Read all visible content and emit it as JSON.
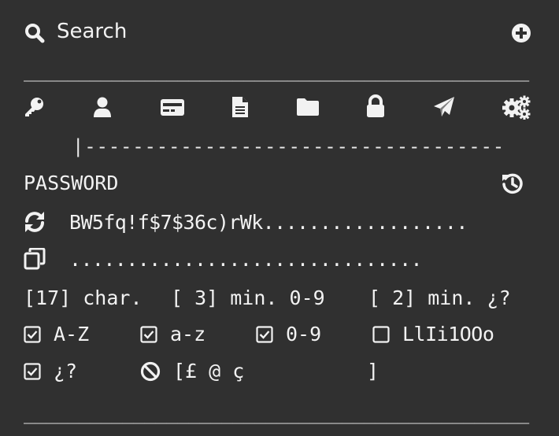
{
  "search": {
    "label": "Search",
    "icon": "search-icon",
    "add_icon": "plus-circle-icon"
  },
  "separators": {
    "top": "______________________________________________",
    "tab_indicator": "|-----------------------------------",
    "bottom": "______________________________________________"
  },
  "tabs": [
    {
      "name": "key",
      "icon": "key-icon"
    },
    {
      "name": "user",
      "icon": "user-icon"
    },
    {
      "name": "card",
      "icon": "credit-card-icon"
    },
    {
      "name": "document",
      "icon": "file-text-icon"
    },
    {
      "name": "folder",
      "icon": "folder-icon"
    },
    {
      "name": "lock",
      "icon": "lock-icon"
    },
    {
      "name": "send",
      "icon": "paper-plane-icon"
    },
    {
      "name": "settings",
      "icon": "gears-icon"
    }
  ],
  "password": {
    "heading": "PASSWORD",
    "history_icon": "history-icon",
    "regenerate_icon": "refresh-icon",
    "value": "BW5fq!f$7$36c)rWk..................",
    "copy_icon": "copy-icon",
    "copy_line": "..............................."
  },
  "options": {
    "length": "[17] char.",
    "min_numbers": "[ 3] min. 0-9",
    "min_special": "[ 2] min. ¿?",
    "uppercase": {
      "label": "A-Z",
      "checked": true
    },
    "lowercase": {
      "label": "a-z",
      "checked": true
    },
    "numbers": {
      "label": "0-9",
      "checked": true
    },
    "ambiguous": {
      "label": "LlIi1OOo",
      "checked": false
    },
    "special": {
      "label": "¿?",
      "checked": true
    },
    "exclude": {
      "icon": "ban-icon",
      "label": "[£ @ ç",
      "close": "]"
    }
  },
  "colors": {
    "background": "#303030",
    "foreground": "#f2f2f2"
  }
}
